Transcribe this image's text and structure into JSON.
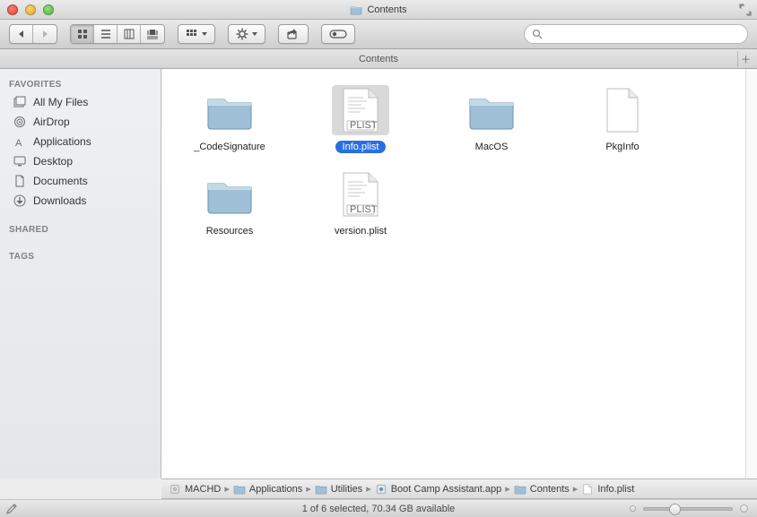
{
  "window": {
    "title": "Contents",
    "tab_label": "Contents"
  },
  "sidebar": {
    "sections": {
      "favorites": "FAVORITES",
      "shared": "SHARED",
      "tags": "TAGS"
    },
    "items": [
      {
        "label": "All My Files",
        "icon": "all-my-files-icon"
      },
      {
        "label": "AirDrop",
        "icon": "airdrop-icon"
      },
      {
        "label": "Applications",
        "icon": "applications-icon"
      },
      {
        "label": "Desktop",
        "icon": "desktop-icon"
      },
      {
        "label": "Documents",
        "icon": "documents-icon"
      },
      {
        "label": "Downloads",
        "icon": "downloads-icon"
      }
    ]
  },
  "files": [
    {
      "name": "_CodeSignature",
      "kind": "folder",
      "selected": false
    },
    {
      "name": "Info.plist",
      "kind": "plist",
      "selected": true
    },
    {
      "name": "MacOS",
      "kind": "folder",
      "selected": false
    },
    {
      "name": "PkgInfo",
      "kind": "file",
      "selected": false
    },
    {
      "name": "Resources",
      "kind": "folder",
      "selected": false
    },
    {
      "name": "version.plist",
      "kind": "plist",
      "selected": false
    }
  ],
  "pathbar": [
    {
      "label": "MACHD",
      "icon": "disk-icon"
    },
    {
      "label": "Applications",
      "icon": "folder-icon"
    },
    {
      "label": "Utilities",
      "icon": "folder-icon"
    },
    {
      "label": "Boot Camp Assistant.app",
      "icon": "app-icon"
    },
    {
      "label": "Contents",
      "icon": "folder-icon"
    },
    {
      "label": "Info.plist",
      "icon": "plist-icon"
    }
  ],
  "status": {
    "text": "1 of 6 selected, 70.34 GB available"
  },
  "search": {
    "placeholder": ""
  },
  "colors": {
    "selection": "#2a6fe0",
    "folder": "#9fc0d6"
  }
}
